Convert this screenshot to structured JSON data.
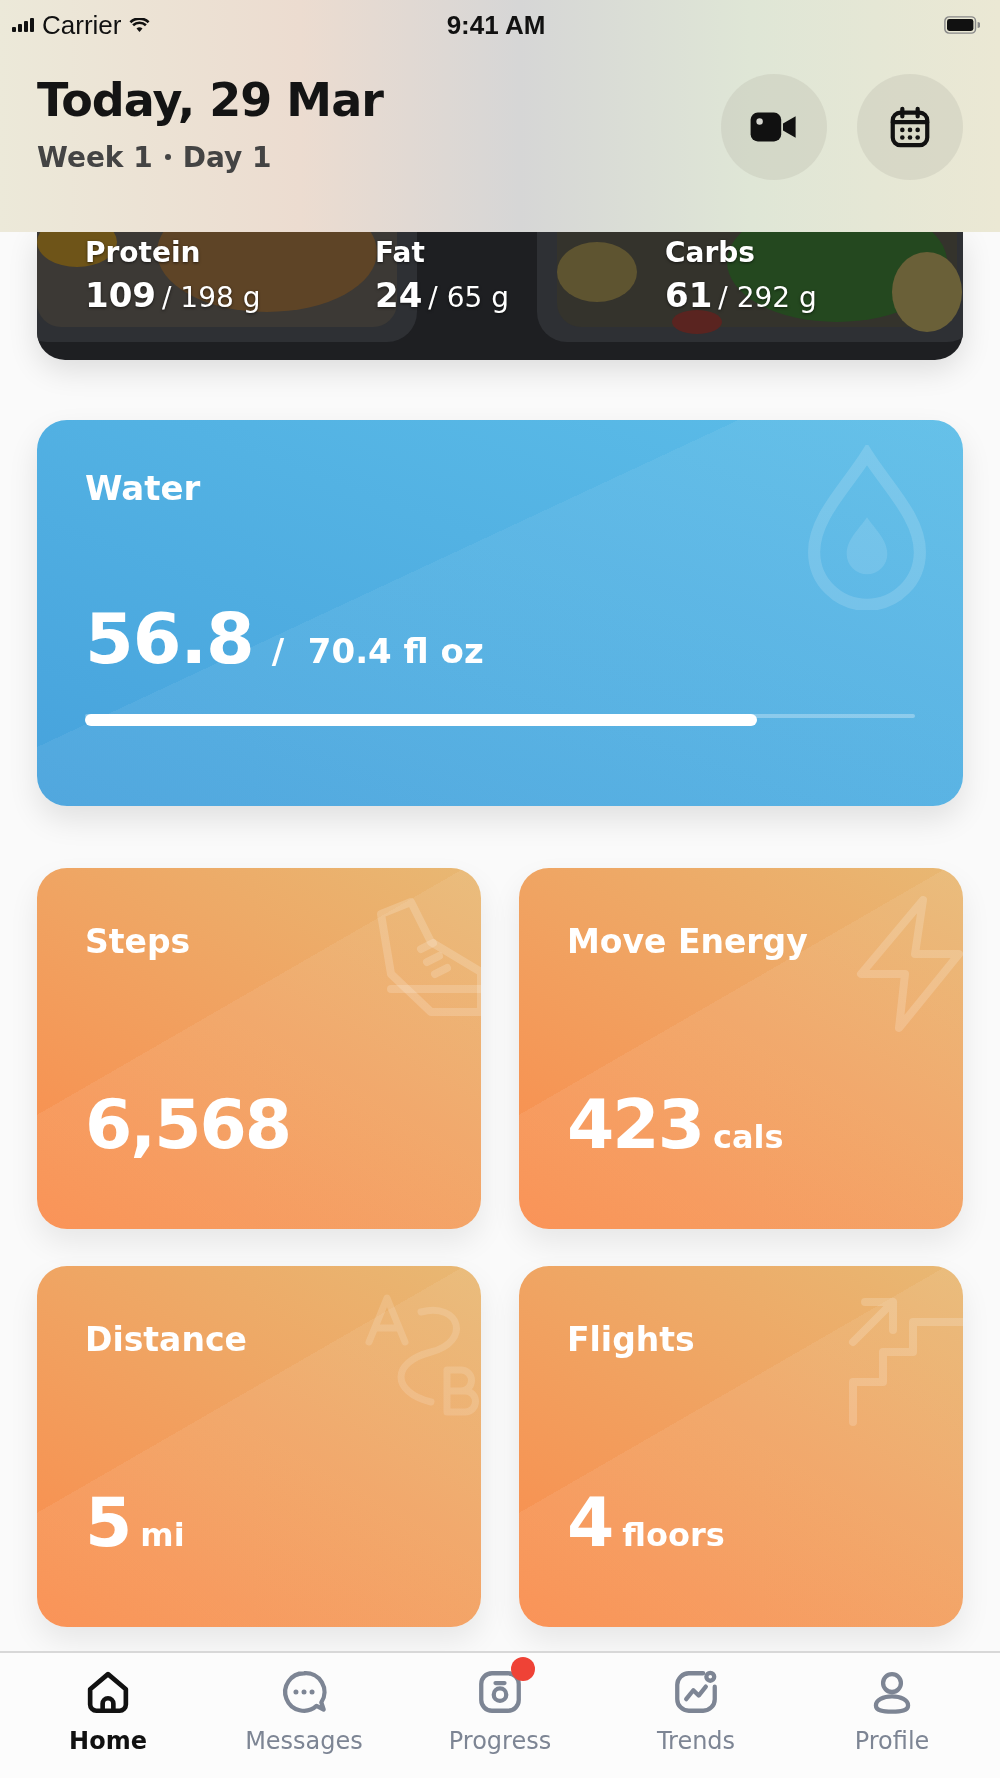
{
  "status_bar": {
    "carrier": "Carrier",
    "time": "9:41 AM"
  },
  "header": {
    "title": "Today, 29 Mar",
    "week": "Week 1",
    "day": "Day 1"
  },
  "macros": [
    {
      "label": "Protein",
      "value": "109",
      "target": "/ 198 g"
    },
    {
      "label": "Fat",
      "value": "24",
      "target": "/ 65 g"
    },
    {
      "label": "Carbs",
      "value": "61",
      "target": "/ 292 g"
    }
  ],
  "water": {
    "title": "Water",
    "value": "56.8",
    "target": "/  70.4 fl oz",
    "level": 0.81
  },
  "tiles": [
    {
      "kind": "steps",
      "title": "Steps",
      "value": "6,568"
    },
    {
      "kind": "energy",
      "title": "Move Energy",
      "value": "423",
      "unit": "cals"
    },
    {
      "kind": "distance",
      "title": "Distance",
      "value": "5",
      "unit": "mi"
    },
    {
      "kind": "flights",
      "title": "Flights",
      "value": "4",
      "unit": "floors"
    }
  ],
  "tabs": [
    {
      "kind": "home",
      "label": "Home",
      "selected": true,
      "badge": false
    },
    {
      "kind": "messages",
      "label": "Messages",
      "selected": false,
      "badge": false
    },
    {
      "kind": "progress",
      "label": "Progress",
      "selected": false,
      "badge": true
    },
    {
      "kind": "trends",
      "label": "Trends",
      "selected": false,
      "badge": false
    },
    {
      "kind": "profile",
      "label": "Profile",
      "selected": false,
      "badge": false
    }
  ]
}
